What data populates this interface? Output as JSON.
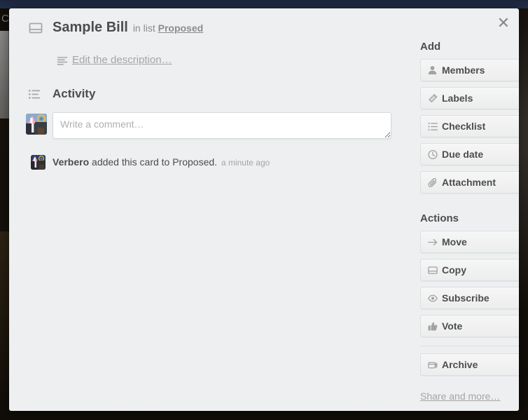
{
  "backdrop": {
    "board_letter": "C"
  },
  "modal": {
    "close_label": "✕",
    "card_icon": "card-icon",
    "title": "Sample Bill",
    "in_list_prefix": "in list",
    "list_name": "Proposed",
    "description_link": "Edit the description…",
    "activity_heading": "Activity",
    "comment_placeholder": "Write a comment…",
    "comment_value": "",
    "activity": [
      {
        "actor": "Verbero",
        "text": "added this card to Proposed.",
        "time": "a minute ago"
      }
    ]
  },
  "sidebar": {
    "add_heading": "Add",
    "add_items": [
      {
        "label": "Members",
        "icon": "person-icon"
      },
      {
        "label": "Labels",
        "icon": "tag-icon"
      },
      {
        "label": "Checklist",
        "icon": "checklist-icon"
      },
      {
        "label": "Due date",
        "icon": "clock-icon"
      },
      {
        "label": "Attachment",
        "icon": "paperclip-icon"
      }
    ],
    "actions_heading": "Actions",
    "action_items": [
      {
        "label": "Move",
        "icon": "arrow-right-icon"
      },
      {
        "label": "Copy",
        "icon": "card-icon"
      },
      {
        "label": "Subscribe",
        "icon": "eye-icon"
      },
      {
        "label": "Vote",
        "icon": "thumbs-up-icon"
      }
    ],
    "archive": {
      "label": "Archive",
      "icon": "archive-icon"
    },
    "share_link": "Share and more…"
  },
  "colors": {
    "modal_bg": "#edeff0",
    "text": "#4d4d4d",
    "muted": "#a5a5a5",
    "button_bg": "#f3f4f4",
    "button_border": "#dcdfe0"
  }
}
